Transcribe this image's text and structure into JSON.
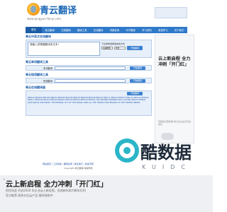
{
  "header": {
    "logo_title": "青云翻译",
    "logo_url": "www.qingyun-fanyi.com"
  },
  "nav": {
    "items": [
      "首页",
      "英汉翻译",
      "汉英翻译",
      "翻译工具",
      "在线翻译",
      "词典查询",
      "句子翻译",
      "学习资料",
      "英语学习",
      "关于我们"
    ]
  },
  "section1": {
    "title": "青云中英文在线翻译",
    "textarea_value": "请输入您需要翻译的文本！",
    "dropdown_label": "下拉菜单选择语言和方式",
    "select_a": "自动检测",
    "select_b": "中文",
    "button": "开始翻译"
  },
  "section2": {
    "title": "青云单词翻译工具",
    "label": "单词翻译:",
    "button": "开始翻译"
  },
  "section3": {
    "title": "青云短语翻译工具",
    "label": "短语翻译:",
    "button": "开始翻译"
  },
  "section4": {
    "title": "青云在线翻译器",
    "button": "开始翻译",
    "body_text": "EE0101 EE0102 EE0103 EE0104 EE0105 EE0106 EE0107 EE0108 EE0109 EE0110 EE0111 EE0112 EE0113 EE0114 EE0115 EE0116 EE0117 EE0118 EE0119 EE0120 EE0121 EE0122 EE0123 EE0124 EE0125 THE ANCIENT ROMANS HAD A SAYING ABOUT PEOPLE WHO ARE IN OUR MIDST. THE ETERNAL CITY OF THE WORLD AND ALL THE THINGS THAT BELONG TO THE HIGHER ORDER..."
  },
  "footer": {
    "links": "网站首页 | 工具导航 | 翻译资源 | 联系我们 | 免责声明",
    "copy": "Copyright 青云翻译 版权所有"
  },
  "side_ad": {
    "headline": "云上新启程 全力冲刺「开门红」",
    "tagline": "轻量级云服务器 助力企业业务高速增长"
  },
  "bottom_ad": {
    "headline": "云上新启程 全力冲刺「开门红」",
    "sub1": "抓住机会 开启2024 年企业云上新征程，优选新年助力新年红利",
    "sub2": "官方推荐 高性价比云产品 限时抢购中"
  },
  "watermark": {
    "title": "酷数据",
    "sub": "KUIDC"
  }
}
